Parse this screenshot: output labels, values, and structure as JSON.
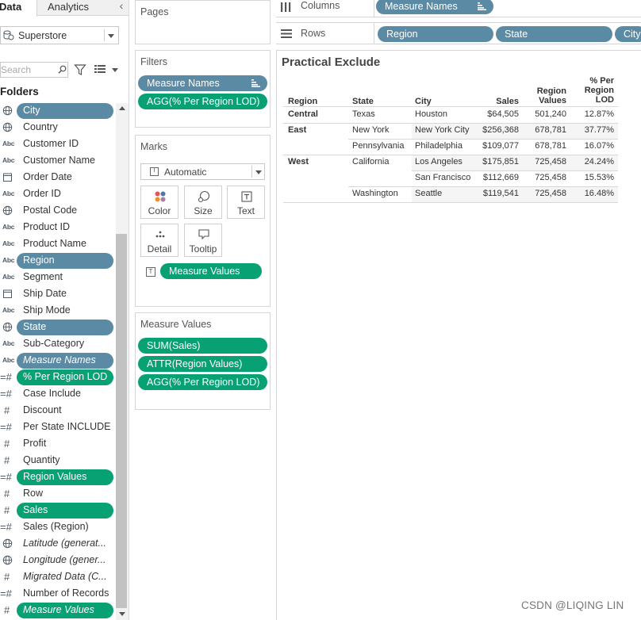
{
  "data_pane": {
    "tabs": [
      "Data",
      "Analytics"
    ],
    "collapse_glyph": "‹",
    "datasource": "Superstore",
    "search_placeholder": "Search",
    "folders_label": "Folders",
    "fields": [
      {
        "name": "City",
        "icon": "globe",
        "style": "blue"
      },
      {
        "name": "Country",
        "icon": "globe",
        "style": ""
      },
      {
        "name": "Customer ID",
        "icon": "abc",
        "style": ""
      },
      {
        "name": "Customer Name",
        "icon": "abc",
        "style": ""
      },
      {
        "name": "Order Date",
        "icon": "calendar",
        "style": ""
      },
      {
        "name": "Order ID",
        "icon": "abc",
        "style": ""
      },
      {
        "name": "Postal Code",
        "icon": "globe",
        "style": ""
      },
      {
        "name": "Product ID",
        "icon": "abc",
        "style": ""
      },
      {
        "name": "Product Name",
        "icon": "abc",
        "style": ""
      },
      {
        "name": "Region",
        "icon": "abc",
        "style": "blue"
      },
      {
        "name": "Segment",
        "icon": "abc",
        "style": ""
      },
      {
        "name": "Ship Date",
        "icon": "calendar",
        "style": ""
      },
      {
        "name": "Ship Mode",
        "icon": "abc",
        "style": ""
      },
      {
        "name": "State",
        "icon": "globe",
        "style": "blue"
      },
      {
        "name": "Sub-Category",
        "icon": "abc",
        "style": ""
      },
      {
        "name": "Measure Names",
        "icon": "abc",
        "style": "blue italic"
      },
      {
        "name": "% Per Region LOD",
        "icon": "calc-measure",
        "style": "green"
      },
      {
        "name": "Case Include",
        "icon": "calc-measure",
        "style": ""
      },
      {
        "name": "Discount",
        "icon": "measure",
        "style": ""
      },
      {
        "name": "Per State INCLUDE",
        "icon": "calc-measure",
        "style": ""
      },
      {
        "name": "Profit",
        "icon": "measure",
        "style": ""
      },
      {
        "name": "Quantity",
        "icon": "measure",
        "style": ""
      },
      {
        "name": "Region Values",
        "icon": "calc-measure",
        "style": "green"
      },
      {
        "name": "Row",
        "icon": "measure",
        "style": ""
      },
      {
        "name": "Sales",
        "icon": "measure",
        "style": "green"
      },
      {
        "name": "Sales (Region)",
        "icon": "calc-measure",
        "style": ""
      },
      {
        "name": "Latitude (generat...",
        "icon": "globe",
        "style": "italic"
      },
      {
        "name": "Longitude (gener...",
        "icon": "globe",
        "style": "italic"
      },
      {
        "name": "Migrated Data (C...",
        "icon": "measure",
        "style": "italic"
      },
      {
        "name": "Number of Records",
        "icon": "calc-measure",
        "style": ""
      },
      {
        "name": "Measure Values",
        "icon": "measure",
        "style": "green italic"
      }
    ],
    "icon_text": {
      "abc": "Abc",
      "measure": "#",
      "calc-measure": "=#"
    }
  },
  "pages_card": {
    "title": "Pages"
  },
  "filters_card": {
    "title": "Filters",
    "pills": [
      {
        "label": "Measure Names",
        "color": "blue"
      },
      {
        "label": "AGG(% Per Region LOD)",
        "color": "green"
      }
    ]
  },
  "marks_card": {
    "title": "Marks",
    "mark_type": "Automatic",
    "buttons": [
      "Color",
      "Size",
      "Text",
      "Detail",
      "Tooltip"
    ],
    "text_pill": "Measure Values"
  },
  "measure_values_card": {
    "title": "Measure Values",
    "pills": [
      "SUM(Sales)",
      "ATTR(Region Values)",
      "AGG(% Per Region LOD)"
    ]
  },
  "columns_shelf": {
    "label": "Columns",
    "pills": [
      "Measure Names"
    ]
  },
  "rows_shelf": {
    "label": "Rows",
    "pills": [
      "Region",
      "State",
      "City"
    ]
  },
  "view": {
    "title": "Practical Exclude",
    "headers": {
      "region": "Region",
      "state": "State",
      "city": "City",
      "sales": "Sales",
      "region_values": [
        "Region",
        "Values"
      ],
      "pct": [
        "% Per",
        "Region",
        "LOD"
      ]
    },
    "rows": [
      {
        "region": "Central",
        "state": "Texas",
        "city": "Houston",
        "sales": "$64,505",
        "region_values": "501,240",
        "pct": "12.87%"
      },
      {
        "region": "East",
        "state": "New York",
        "city": "New York City",
        "sales": "$256,368",
        "region_values": "678,781",
        "pct": "37.77%"
      },
      {
        "region": "",
        "state": "Pennsylvania",
        "city": "Philadelphia",
        "sales": "$109,077",
        "region_values": "678,781",
        "pct": "16.07%"
      },
      {
        "region": "West",
        "state": "California",
        "city": "Los Angeles",
        "sales": "$175,851",
        "region_values": "725,458",
        "pct": "24.24%"
      },
      {
        "region": "",
        "state": "",
        "city": "San Francisco",
        "sales": "$112,669",
        "region_values": "725,458",
        "pct": "15.53%"
      },
      {
        "region": "",
        "state": "Washington",
        "city": "Seattle",
        "sales": "$119,541",
        "region_values": "725,458",
        "pct": "16.48%"
      }
    ]
  },
  "watermark": "CSDN @LIQING LIN",
  "colors": {
    "dimension_pill": "#5b8ba4",
    "measure_pill": "#08a174"
  }
}
